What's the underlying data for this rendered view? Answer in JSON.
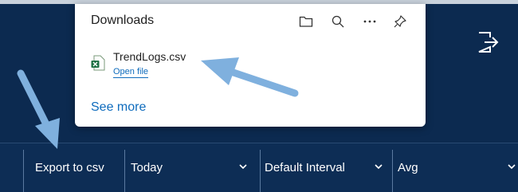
{
  "downloads": {
    "title": "Downloads",
    "icons": [
      "folder-icon",
      "search-icon",
      "more-options-icon",
      "pin-icon"
    ],
    "file": {
      "name": "TrendLogs.csv",
      "action": "Open file",
      "icon": "excel-csv-file-icon"
    },
    "see_more": "See more"
  },
  "toolbar": {
    "export_label": "Export to csv",
    "range": {
      "selected": "Today"
    },
    "interval": {
      "selected": "Default Interval"
    },
    "aggregate": {
      "selected": "Avg"
    }
  },
  "colors": {
    "app_background": "#0c2a50",
    "link": "#0f6cbd",
    "annotation_arrow": "#7fb0de"
  }
}
